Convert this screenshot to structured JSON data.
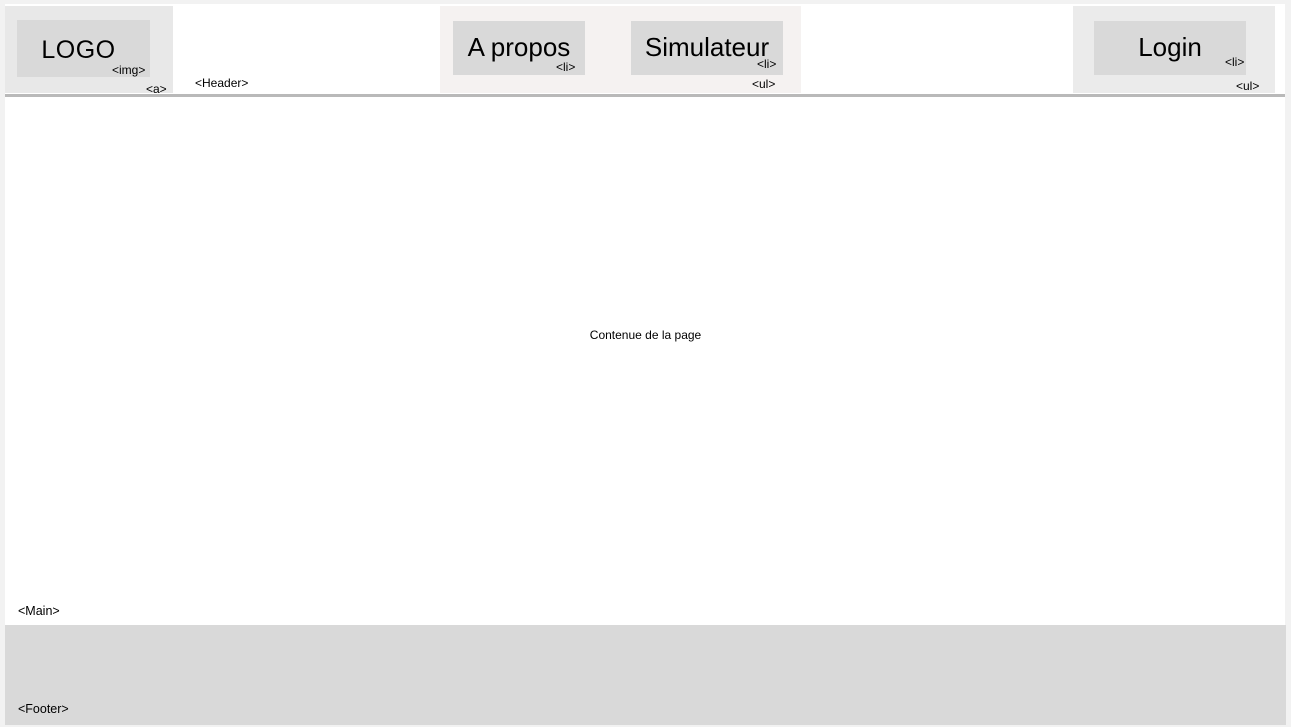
{
  "header": {
    "tag": "<Header>",
    "logo": {
      "text": "LOGO",
      "img_tag": "<img>",
      "link_tag": "<a>"
    },
    "nav": {
      "items": [
        {
          "label": "A propos",
          "tag": "<li>"
        },
        {
          "label": "Simulateur",
          "tag": "<li>"
        }
      ],
      "list_tag": "<ul>"
    },
    "login": {
      "label": "Login",
      "item_tag": "<li>",
      "list_tag": "<ul>"
    }
  },
  "main": {
    "tag": "<Main>",
    "content_text": "Contenue de la page"
  },
  "footer": {
    "tag": "<Footer>"
  },
  "colors": {
    "page_background": "#f2f2f2",
    "block_fill": "#d9d9d9",
    "header_rule": "#b9b9b9"
  }
}
